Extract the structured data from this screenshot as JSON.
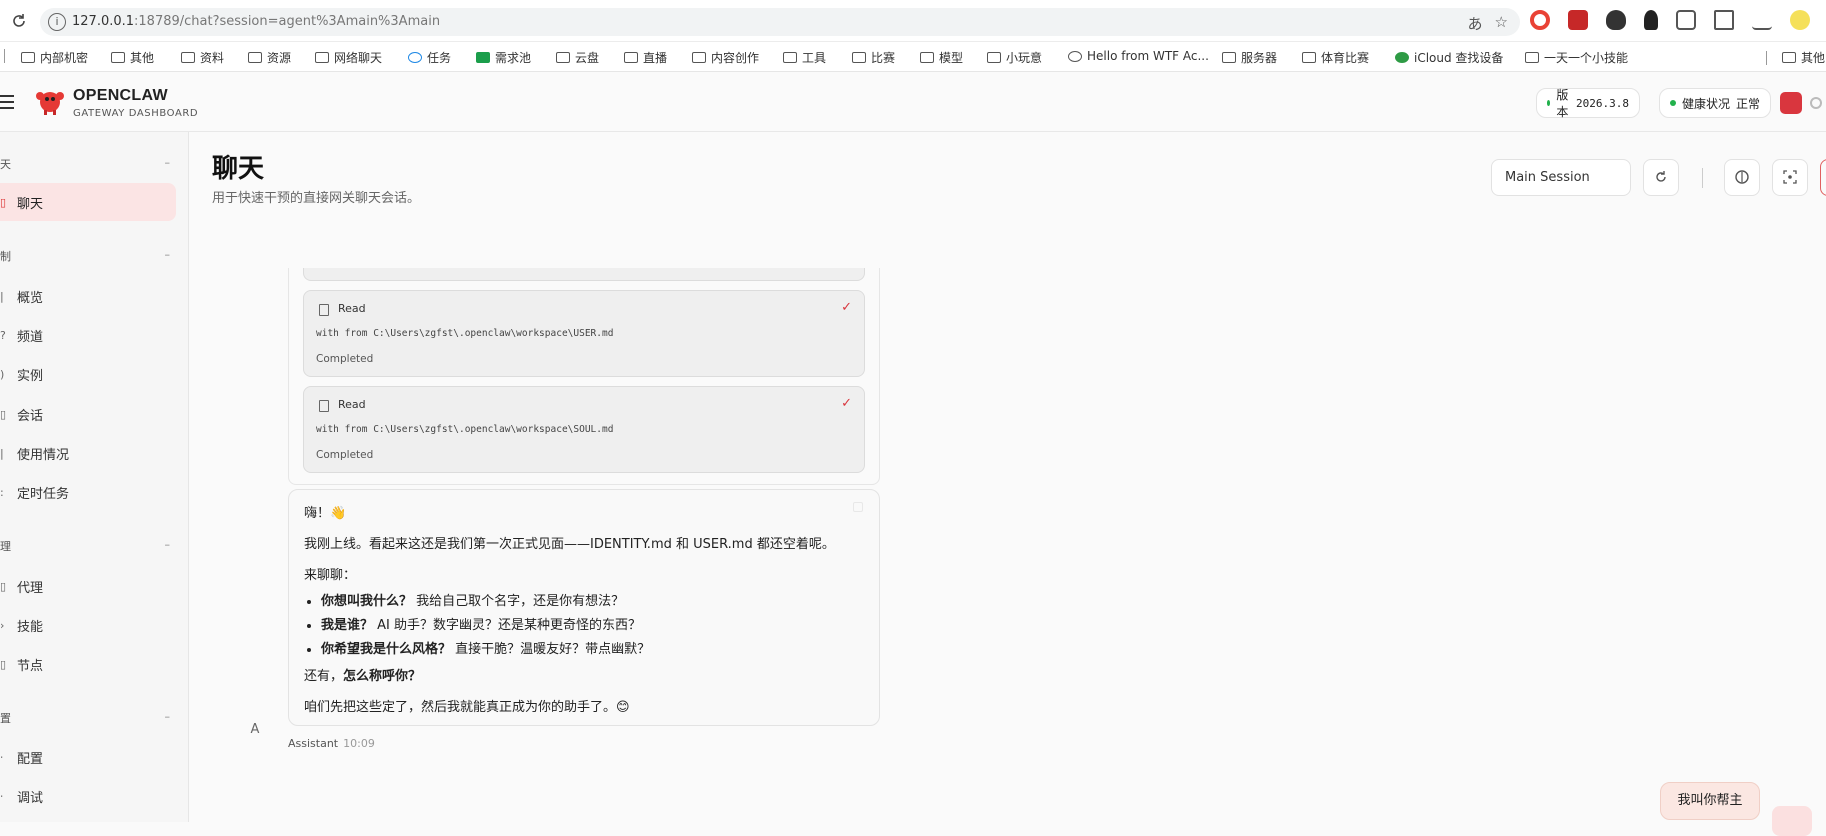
{
  "browser": {
    "url_host": "127.0.0.1",
    "url_rest": ":18789/chat?session=agent%3Amain%3Amain",
    "bookmarks": [
      "内部机密",
      "其他",
      "资料",
      "资源",
      "网络聊天",
      "任务",
      "需求池",
      "云盘",
      "直播",
      "内容创作",
      "工具",
      "比赛",
      "模型",
      "小玩意",
      "Hello from WTF Ac...",
      "服务器",
      "体育比赛",
      "iCloud 查找设备",
      "一天一个小技能",
      "其他"
    ]
  },
  "header": {
    "brand": "OPENCLAW",
    "brand_sub": "GATEWAY DASHBOARD",
    "version_label": "版本",
    "version_value": "2026.3.8",
    "health_label": "健康状况",
    "health_value": "正常",
    "status_color": "#22b14c"
  },
  "sidebar": {
    "sections": [
      {
        "title": "天",
        "items": [
          {
            "label": "聊天",
            "icon": "chat-icon",
            "active": true
          }
        ]
      },
      {
        "title": "制",
        "items": [
          {
            "label": "概览",
            "icon": "chart-icon"
          },
          {
            "label": "频道",
            "icon": "link-icon"
          },
          {
            "label": "实例",
            "icon": "radio-icon"
          },
          {
            "label": "会话",
            "icon": "doc-icon"
          },
          {
            "label": "使用情况",
            "icon": "bar-icon"
          },
          {
            "label": "定时任务",
            "icon": "clock-icon"
          }
        ]
      },
      {
        "title": "理",
        "items": [
          {
            "label": "代理",
            "icon": "folder-icon"
          },
          {
            "label": "技能",
            "icon": "bolt-icon"
          },
          {
            "label": "节点",
            "icon": "node-icon"
          }
        ]
      },
      {
        "title": "置",
        "items": [
          {
            "label": "配置",
            "icon": "settings-icon"
          },
          {
            "label": "调试",
            "icon": "bug-icon"
          }
        ]
      }
    ],
    "collapse_symbol": "–"
  },
  "main": {
    "title": "聊天",
    "subtitle": "用于快速干预的直接网关聊天会话。",
    "session_select": "Main Session",
    "tools": [
      {
        "name": "Read",
        "detail": "with from C:\\Users\\zgfst\\.openclaw\\workspace\\USER.md",
        "status": "Completed"
      },
      {
        "name": "Read",
        "detail": "with from C:\\Users\\zgfst\\.openclaw\\workspace\\SOUL.md",
        "status": "Completed"
      }
    ],
    "message": {
      "greeting": "嗨！👋",
      "line1": "我刚上线。看起来这还是我们第一次正式见面——IDENTITY.md 和 USER.md 都还空着呢。",
      "line2": "来聊聊：",
      "bullets": [
        {
          "bold": "你想叫我什么？",
          "rest": " 我给自己取个名字，还是你有想法？"
        },
        {
          "bold": "我是谁？",
          "rest": " AI 助手？数字幽灵？还是某种更奇怪的东西？"
        },
        {
          "bold": "你希望我是什么风格？",
          "rest": " 直接干脆？温暖友好？带点幽默？"
        }
      ],
      "also_prefix": "还有，",
      "also_bold": "怎么称呼你？",
      "closing": "咱们先把这些定了，然后我就能真正成为你的助手了。😊"
    },
    "avatar_letter": "A",
    "sender": "Assistant",
    "time": "10:09",
    "user_message": "我叫你帮主"
  }
}
